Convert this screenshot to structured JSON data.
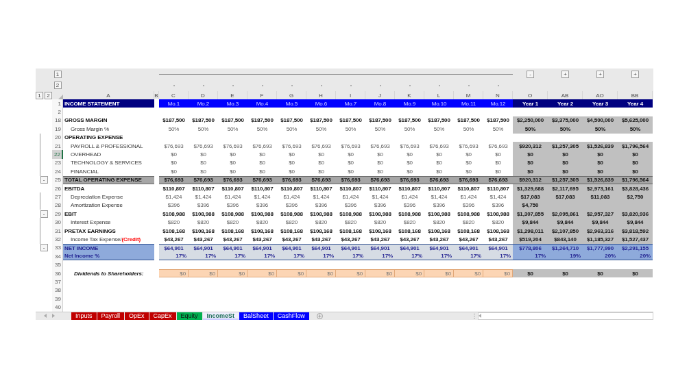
{
  "outline_levels": {
    "rows": [
      "1",
      "2"
    ],
    "columns": [
      "1",
      "2"
    ]
  },
  "columns": [
    {
      "letter": "A",
      "kind": "label"
    },
    {
      "letter": "B",
      "kind": "spacer"
    },
    {
      "letter": "C",
      "kind": "month"
    },
    {
      "letter": "D",
      "kind": "month"
    },
    {
      "letter": "E",
      "kind": "month"
    },
    {
      "letter": "F",
      "kind": "month"
    },
    {
      "letter": "G",
      "kind": "month"
    },
    {
      "letter": "H",
      "kind": "month"
    },
    {
      "letter": "I",
      "kind": "month"
    },
    {
      "letter": "J",
      "kind": "month"
    },
    {
      "letter": "K",
      "kind": "month"
    },
    {
      "letter": "L",
      "kind": "month"
    },
    {
      "letter": "M",
      "kind": "month"
    },
    {
      "letter": "N",
      "kind": "month"
    },
    {
      "letter": "O",
      "kind": "year",
      "toggle": "-"
    },
    {
      "letter": "AB",
      "kind": "year",
      "toggle": "+"
    },
    {
      "letter": "AO",
      "kind": "year",
      "toggle": "+"
    },
    {
      "letter": "BB",
      "kind": "year",
      "toggle": "+"
    }
  ],
  "rows": [
    {
      "num": "1",
      "kind": "header",
      "selected": false,
      "grouped": false,
      "label": "INCOME STATEMENT",
      "months": [
        "Mo.1",
        "Mo.2",
        "Mo.3",
        "Mo.4",
        "Mo.5",
        "Mo.6",
        "Mo.7",
        "Mo.8",
        "Mo.9",
        "Mo.10",
        "Mo.11",
        "Mo.12"
      ],
      "years": [
        "Year 1",
        "Year 2",
        "Year 3",
        "Year 4"
      ]
    },
    {
      "num": "2",
      "kind": "blank",
      "selected": false,
      "grouped": false
    },
    {
      "num": "18",
      "kind": "bold",
      "selected": false,
      "grouped": false,
      "label": "GROSS MARGIN",
      "months": [
        "$187,500",
        "$187,500",
        "$187,500",
        "$187,500",
        "$187,500",
        "$187,500",
        "$187,500",
        "$187,500",
        "$187,500",
        "$187,500",
        "$187,500",
        "$187,500"
      ],
      "years": [
        "$2,250,000",
        "$3,375,000",
        "$4,500,000",
        "$5,625,000"
      ]
    },
    {
      "num": "19",
      "kind": "item",
      "selected": false,
      "grouped": false,
      "label": "Gross Margin %",
      "months": [
        "50%",
        "50%",
        "50%",
        "50%",
        "50%",
        "50%",
        "50%",
        "50%",
        "50%",
        "50%",
        "50%",
        "50%"
      ],
      "years": [
        "50%",
        "50%",
        "50%",
        "50%"
      ]
    },
    {
      "num": "20",
      "kind": "section",
      "selected": false,
      "grouped": true,
      "label": "OPERATING EXPENSE"
    },
    {
      "num": "21",
      "kind": "item",
      "selected": false,
      "grouped": true,
      "label": "PAYROLL & PROFESSIONAL",
      "months": [
        "$76,693",
        "$76,693",
        "$76,693",
        "$76,693",
        "$76,693",
        "$76,693",
        "$76,693",
        "$76,693",
        "$76,693",
        "$76,693",
        "$76,693",
        "$76,693"
      ],
      "years": [
        "$920,312",
        "$1,257,305",
        "$1,526,839",
        "$1,796,564"
      ]
    },
    {
      "num": "22",
      "kind": "item",
      "selected": true,
      "grouped": true,
      "label": "OVERHEAD",
      "months": [
        "$0",
        "$0",
        "$0",
        "$0",
        "$0",
        "$0",
        "$0",
        "$0",
        "$0",
        "$0",
        "$0",
        "$0"
      ],
      "years": [
        "$0",
        "$0",
        "$0",
        "$0"
      ]
    },
    {
      "num": "23",
      "kind": "item",
      "selected": false,
      "grouped": true,
      "label": "TECHNOLOGY & SERVICES",
      "months": [
        "$0",
        "$0",
        "$0",
        "$0",
        "$0",
        "$0",
        "$0",
        "$0",
        "$0",
        "$0",
        "$0",
        "$0"
      ],
      "years": [
        "$0",
        "$0",
        "$0",
        "$0"
      ]
    },
    {
      "num": "24",
      "kind": "item",
      "selected": false,
      "grouped": true,
      "label": "FINANCIAL",
      "months": [
        "$0",
        "$0",
        "$0",
        "$0",
        "$0",
        "$0",
        "$0",
        "$0",
        "$0",
        "$0",
        "$0",
        "$0"
      ],
      "years": [
        "$0",
        "$0",
        "$0",
        "$0"
      ]
    },
    {
      "num": "25",
      "kind": "total",
      "selected": false,
      "grouped": false,
      "toggle": "-",
      "label": "TOTAL OPERATING EXPENSE",
      "months": [
        "$76,693",
        "$76,693",
        "$76,693",
        "$76,693",
        "$76,693",
        "$76,693",
        "$76,693",
        "$76,693",
        "$76,693",
        "$76,693",
        "$76,693",
        "$76,693"
      ],
      "years": [
        "$920,312",
        "$1,257,305",
        "$1,526,839",
        "$1,796,564"
      ]
    },
    {
      "num": "26",
      "kind": "bold",
      "selected": false,
      "grouped": false,
      "label": "EBITDA",
      "months": [
        "$110,807",
        "$110,807",
        "$110,807",
        "$110,807",
        "$110,807",
        "$110,807",
        "$110,807",
        "$110,807",
        "$110,807",
        "$110,807",
        "$110,807",
        "$110,807"
      ],
      "years": [
        "$1,329,688",
        "$2,117,695",
        "$2,973,161",
        "$3,828,436"
      ]
    },
    {
      "num": "27",
      "kind": "item",
      "selected": false,
      "grouped": true,
      "label": "Depreciation Expense",
      "months": [
        "$1,424",
        "$1,424",
        "$1,424",
        "$1,424",
        "$1,424",
        "$1,424",
        "$1,424",
        "$1,424",
        "$1,424",
        "$1,424",
        "$1,424",
        "$1,424"
      ],
      "years": [
        "$17,083",
        "$17,083",
        "$11,083",
        "$2,750"
      ]
    },
    {
      "num": "28",
      "kind": "item",
      "selected": false,
      "grouped": true,
      "label": "Amortization Expense",
      "months": [
        "$396",
        "$396",
        "$396",
        "$396",
        "$396",
        "$396",
        "$396",
        "$396",
        "$396",
        "$396",
        "$396",
        "$396"
      ],
      "years": [
        "$4,750"
      ]
    },
    {
      "num": "29",
      "kind": "bold",
      "selected": false,
      "grouped": false,
      "toggle": "-",
      "label": "EBIT",
      "months": [
        "$108,988",
        "$108,988",
        "$108,988",
        "$108,988",
        "$108,988",
        "$108,988",
        "$108,988",
        "$108,988",
        "$108,988",
        "$108,988",
        "$108,988",
        "$108,988"
      ],
      "years": [
        "$1,307,855",
        "$2,095,861",
        "$2,957,327",
        "$3,820,936"
      ]
    },
    {
      "num": "30",
      "kind": "item",
      "selected": false,
      "grouped": true,
      "label": "Interest Expense",
      "months": [
        "$820",
        "$820",
        "$820",
        "$820",
        "$820",
        "$820",
        "$820",
        "$820",
        "$820",
        "$820",
        "$820",
        "$820"
      ],
      "years": [
        "$9,844",
        "$9,844",
        "$9,844",
        "$9,844"
      ]
    },
    {
      "num": "31",
      "kind": "bold",
      "selected": false,
      "grouped": true,
      "label": "PRETAX EARNINGS",
      "months": [
        "$108,168",
        "$108,168",
        "$108,168",
        "$108,168",
        "$108,168",
        "$108,168",
        "$108,168",
        "$108,168",
        "$108,168",
        "$108,168",
        "$108,168",
        "$108,168"
      ],
      "years": [
        "$1,298,011",
        "$2,107,850",
        "$2,963,316",
        "$3,818,592"
      ]
    },
    {
      "num": "32",
      "kind": "itembold",
      "selected": false,
      "grouped": true,
      "label": "Income Tax Expense/",
      "label_note": "(Credit)",
      "months": [
        "$43,267",
        "$43,267",
        "$43,267",
        "$43,267",
        "$43,267",
        "$43,267",
        "$43,267",
        "$43,267",
        "$43,267",
        "$43,267",
        "$43,267",
        "$43,267"
      ],
      "years": [
        "$519,204",
        "$843,140",
        "$1,185,327",
        "$1,527,437"
      ]
    },
    {
      "num": "33",
      "kind": "net",
      "selected": false,
      "grouped": false,
      "toggle": "-",
      "label": "NET INCOME",
      "months": [
        "$64,901",
        "$64,901",
        "$64,901",
        "$64,901",
        "$64,901",
        "$64,901",
        "$64,901",
        "$64,901",
        "$64,901",
        "$64,901",
        "$64,901",
        "$64,901"
      ],
      "years": [
        "$778,806",
        "$1,264,710",
        "$1,777,990",
        "$2,291,155"
      ]
    },
    {
      "num": "34",
      "kind": "netpct",
      "selected": false,
      "grouped": false,
      "label": "Net Income %",
      "months": [
        "17%",
        "17%",
        "17%",
        "17%",
        "17%",
        "17%",
        "17%",
        "17%",
        "17%",
        "17%",
        "17%",
        "17%"
      ],
      "years": [
        "17%",
        "19%",
        "20%",
        "20%"
      ]
    },
    {
      "num": "35",
      "kind": "blank",
      "selected": false,
      "grouped": false
    },
    {
      "num": "36",
      "kind": "dividend",
      "selected": false,
      "grouped": false,
      "label": "Dividends to Shareholders:",
      "months": [
        "$0",
        "$0",
        "$0",
        "$0",
        "$0",
        "$0",
        "$0",
        "$0",
        "$0",
        "$0",
        "$0",
        "$0"
      ],
      "years": [
        "$0",
        "$0",
        "$0",
        "$0"
      ]
    },
    {
      "num": "37",
      "kind": "blank",
      "selected": false,
      "grouped": false
    },
    {
      "num": "38",
      "kind": "blank",
      "selected": false,
      "grouped": false
    },
    {
      "num": "39",
      "kind": "blank",
      "selected": false,
      "grouped": false
    },
    {
      "num": "40",
      "kind": "blank",
      "selected": false,
      "grouped": false
    }
  ],
  "sheet_tabs": [
    {
      "name": "Inputs",
      "color": "#c00000",
      "selected": false
    },
    {
      "name": "Payroll",
      "color": "#c00000",
      "selected": false
    },
    {
      "name": "OpEx",
      "color": "#c00000",
      "selected": false
    },
    {
      "name": "CapEx",
      "color": "#c00000",
      "selected": false
    },
    {
      "name": "Equity",
      "color": "#00b050",
      "selected": false
    },
    {
      "name": "IncomeSt",
      "color": "#ccccff",
      "selected": true
    },
    {
      "name": "BalSheet",
      "color": "#0000ff",
      "selected": false
    },
    {
      "name": "CashFlow",
      "color": "#0000ff",
      "selected": false
    }
  ]
}
